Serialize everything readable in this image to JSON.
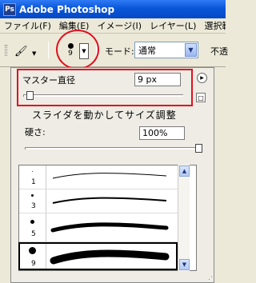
{
  "window": {
    "title": "Adobe Photoshop",
    "app_icon": "Ps"
  },
  "menu": [
    "ファイル(F)",
    "編集(E)",
    "イメージ(I)",
    "レイヤー(L)",
    "選択範"
  ],
  "options_bar": {
    "brush_size": "9",
    "mode_label": "モード:",
    "mode_value": "通常",
    "opacity_label": "不透"
  },
  "brush_panel": {
    "master_diameter_label": "マスター直径",
    "master_diameter_value": "9 px",
    "master_diameter_fraction": 0.02,
    "annotation": "スライダを動かしてサイズ調整",
    "hardness_label": "硬さ:",
    "hardness_value": "100%",
    "hardness_fraction": 1.0,
    "presets": [
      {
        "size": "1"
      },
      {
        "size": "3"
      },
      {
        "size": "5"
      },
      {
        "size": "9",
        "selected": true
      }
    ]
  },
  "colors": {
    "highlight": "#e01020",
    "titlebar": "#0a56d8"
  }
}
